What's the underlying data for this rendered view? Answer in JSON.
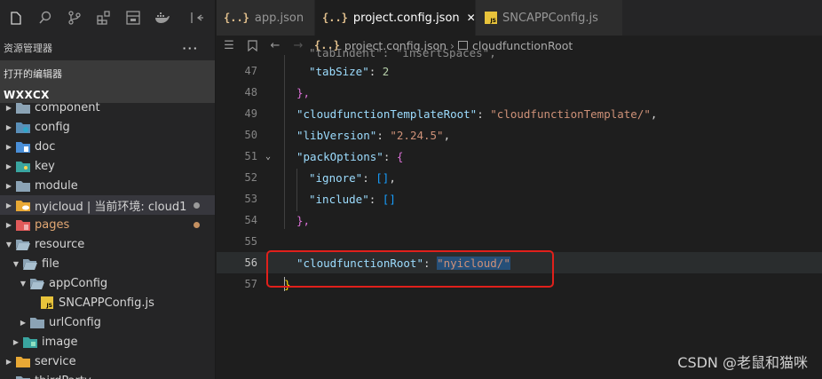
{
  "sidebar": {
    "title": "资源管理器",
    "more": "···",
    "open_editors": "打开的编辑器",
    "workspace": "WXXCX",
    "items": [
      {
        "label": "component",
        "icon": "folder-icon",
        "color": "#8ba3b5",
        "expanded": false
      },
      {
        "label": "config",
        "icon": "config-folder-icon",
        "color": "#5a8fb8",
        "expanded": false
      },
      {
        "label": "doc",
        "icon": "doc-folder-icon",
        "color": "#4a8fd8",
        "expanded": false
      },
      {
        "label": "key",
        "icon": "key-folder-icon",
        "color": "#3aa5a0",
        "expanded": false
      },
      {
        "label": "module",
        "icon": "folder-icon",
        "color": "#8ba3b5",
        "expanded": false
      },
      {
        "label": "nyicloud | 当前环境: cloud1",
        "icon": "cloud-folder-icon",
        "color": "#e8a835",
        "expanded": false
      },
      {
        "label": "pages",
        "icon": "pages-folder-icon",
        "color": "#e05a5a",
        "expanded": false
      },
      {
        "label": "resource",
        "icon": "folder-open-icon",
        "color": "#8ba3b5",
        "expanded": true
      },
      {
        "label": "file",
        "icon": "folder-open-icon",
        "color": "#8ba3b5",
        "expanded": true
      },
      {
        "label": "appConfig",
        "icon": "folder-open-icon",
        "color": "#8ba3b5",
        "expanded": true
      },
      {
        "label": "SNCAPPConfig.js",
        "icon": "js-file-icon"
      },
      {
        "label": "urlConfig",
        "icon": "folder-icon",
        "color": "#8ba3b5",
        "expanded": false
      },
      {
        "label": "image",
        "icon": "image-folder-icon",
        "color": "#3aa5a0",
        "expanded": false
      },
      {
        "label": "service",
        "icon": "service-folder-icon",
        "color": "#e8a835",
        "expanded": false
      },
      {
        "label": "thirdParty",
        "icon": "folder-icon",
        "color": "#8ba3b5",
        "expanded": false
      }
    ]
  },
  "tabs": [
    {
      "label": "app.json",
      "icon": "json-icon"
    },
    {
      "label": "project.config.json",
      "icon": "json-icon",
      "active": true,
      "close": "✕"
    },
    {
      "label": "SNCAPPConfig.js",
      "icon": "js-file-icon"
    }
  ],
  "breadcrumb": {
    "file": "project.config.json",
    "symbol": "cloudfunctionRoot"
  },
  "code": {
    "lines": [
      {
        "n": "47",
        "key": "\"tabSize\"",
        "val": "2"
      },
      {
        "n": "48",
        "text": "},"
      },
      {
        "n": "49",
        "key": "\"cloudfunctionTemplateRoot\"",
        "val": "\"cloudfunctionTemplate/\""
      },
      {
        "n": "50",
        "key": "\"libVersion\"",
        "val": "\"2.24.5\""
      },
      {
        "n": "51",
        "key": "\"packOptions\"",
        "val": "{"
      },
      {
        "n": "52",
        "key": "\"ignore\"",
        "val": "[]"
      },
      {
        "n": "53",
        "key": "\"include\"",
        "val": "[]"
      },
      {
        "n": "54",
        "text": "},"
      },
      {
        "n": "55",
        "text": ""
      },
      {
        "n": "56",
        "key": "\"cloudfunctionRoot\"",
        "val": "\"nyicloud/\""
      },
      {
        "n": "57",
        "text": "}"
      }
    ],
    "partial_top": "\"tabIndent\": \"insertSpaces\","
  },
  "watermark": "CSDN @老鼠和猫咪"
}
